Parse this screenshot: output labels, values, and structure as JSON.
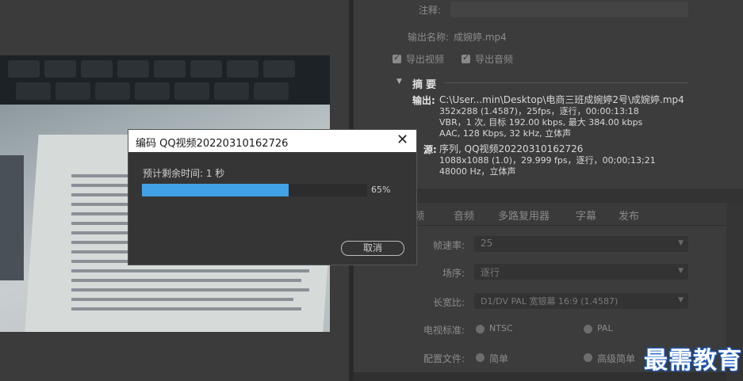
{
  "export_settings": {
    "comment_label": "注释:",
    "output_name_label": "输出名称:",
    "output_name_value": "成婉婷.mp4",
    "export_video_label": "导出视频",
    "export_audio_label": "导出音频",
    "summary_label": "摘要",
    "output_key": "输出:",
    "output_lines": [
      "C:\\User...min\\Desktop\\电商三班成婉婷2号\\成婉婷.mp4",
      "352x288 (1.4587)，25fps，逐行，00:00:13:18",
      "VBR，1 次, 目标 192.00 kbps, 最大 384.00 kbps",
      "AAC, 128 Kbps, 32  kHz, 立体声"
    ],
    "source_key": "源:",
    "source_lines": [
      "序列, QQ视频20220310162726",
      "1088x1088 (1.0)，29.999 fps，逐行，00;00;13;21",
      "48000 Hz，立体声"
    ]
  },
  "tabs": [
    "频",
    "音频",
    "多路复用器",
    "字幕",
    "发布"
  ],
  "video_settings": {
    "frame_rate_label": "帧速率:",
    "frame_rate_value": "25",
    "field_order_label": "场序:",
    "field_order_value": "逐行",
    "aspect_label": "长宽比:",
    "aspect_value": "D1/DV PAL 宽银幕 16:9 (1.4587)",
    "tv_standard_label": "电视标准:",
    "ntsc_label": "NTSC",
    "pal_label": "PAL",
    "profile_label": "配置文件:",
    "profile_simple": "简单",
    "profile_advanced": "高级简单"
  },
  "dialog": {
    "title": "编码 QQ视频20220310162726",
    "close_symbol": "✕",
    "remaining_text": "预计剩余时间: 1 秒",
    "progress": 0.65,
    "progress_text": "65%",
    "cancel_label": "取消"
  },
  "watermark": "最需教育",
  "colors": {
    "progress_fill": "#41a2e6",
    "dialog_bg": "#353535",
    "panel_bg": "#3c3c3c"
  }
}
